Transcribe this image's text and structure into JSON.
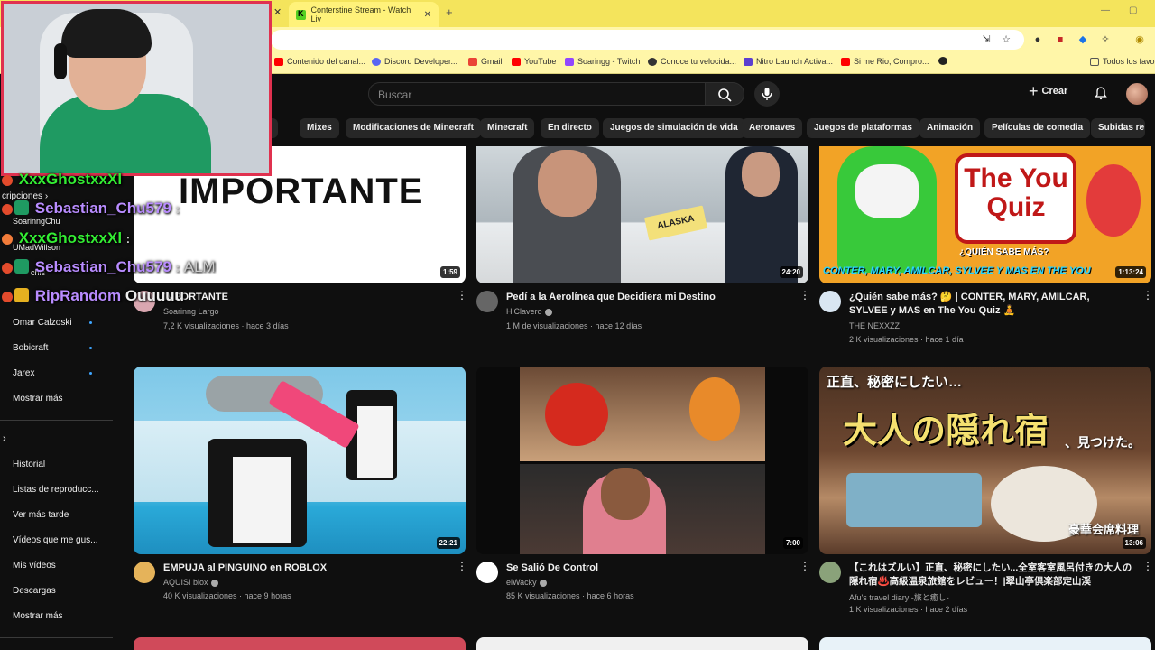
{
  "browser": {
    "active_tab_title": "Conterstine Stream - Watch Liv",
    "bookmarks": [
      {
        "label": "Contenido del canal...",
        "color": "#ff0000"
      },
      {
        "label": "Discord Developer...",
        "color": "#5865f2"
      },
      {
        "label": "Gmail",
        "color": "#ea4335"
      },
      {
        "label": "YouTube",
        "color": "#ff0000"
      },
      {
        "label": "Soaringg - Twitch",
        "color": "#9146ff"
      },
      {
        "label": "Conoce tu velocida...",
        "color": "#333333"
      },
      {
        "label": "Nitro Launch Activa...",
        "color": "#5b3fd0"
      },
      {
        "label": "Si me Rio, Compro...",
        "color": "#ff0000"
      }
    ],
    "other_bookmarks": "Todos los favor"
  },
  "header": {
    "search_placeholder": "Buscar",
    "create_label": "Crear"
  },
  "chips": [
    "ica",
    "Mixes",
    "Modificaciones de Minecraft",
    "Minecraft",
    "En directo",
    "Juegos de simulación de vida",
    "Aeronaves",
    "Juegos de plataformas",
    "Animación",
    "Películas de comedia",
    "Subidas re"
  ],
  "sidebar": {
    "subs_partial": "cripciones",
    "channels": [
      "SoarinngChu",
      "UMadWillson",
      "chis",
      "Omar Calzoski",
      "Bobicraft",
      "Jarex"
    ],
    "show_more": "Mostrar más",
    "you_items": [
      "Historial",
      "Listas de reproducc...",
      "Ver más tarde",
      "Vídeos que me gus...",
      "Mis vídeos",
      "Descargas"
    ],
    "show_more_2": "Mostrar más"
  },
  "videos": [
    {
      "title": "IMPORTANTE",
      "thumb_text": "IMPORTANTE",
      "channel": "Soarinng Largo",
      "meta": "7,2 K visualizaciones · hace 3 días",
      "duration": "1:59",
      "verified": false
    },
    {
      "title": "Pedí a la Aerolínea que Decidiera mi Destino",
      "thumb_text": "ALASKA",
      "channel": "HiClavero",
      "meta": "1 M de visualizaciones · hace 12 días",
      "duration": "24:20",
      "verified": true
    },
    {
      "title": "¿Quién sabe más? 🤔 | CONTER, MARY, AMILCAR, SYLVEE y MAS en The You Quiz 🧘",
      "thumb_text": "The You Quiz",
      "thumb_sub": "¿QUIÉN SABE MÁS?",
      "thumb_sub2": "CONTER, MARY, AMILCAR, SYLVEE Y MAS EN THE YOU",
      "channel": "THE NEXXZZ",
      "meta": "2 K visualizaciones · hace 1 día",
      "duration": "1:13:24",
      "verified": false
    },
    {
      "title": "EMPUJA al PINGUINO en ROBLOX",
      "channel": "AQUISI blox",
      "meta": "40 K visualizaciones · hace 9 horas",
      "duration": "22:21",
      "verified": true
    },
    {
      "title": "Se Salió De Control",
      "channel": "elWacky",
      "meta": "85 K visualizaciones · hace 6 horas",
      "duration": "7:00",
      "verified": true
    },
    {
      "title": "【これはズルい】正直、秘密にしたい...全室客室風呂付きの大人の隠れ宿♨️高級温泉旅館をレビュー！|翠山亭倶楽部定山渓",
      "thumb_text": "大人の隠れ宿",
      "thumb_top": "正直、秘密にしたい…",
      "thumb_after": "、見つけた。",
      "thumb_bottom": "豪華会席料理",
      "channel": "Afu's travel diary -旅と癒し-",
      "meta": "1 K visualizaciones · hace 2 días",
      "duration": "13:06",
      "verified": false
    }
  ],
  "chat": [
    {
      "user": "XxxGhostxxXl",
      "msg": ""
    },
    {
      "user": "Sebastian_Chu579",
      "msg": ""
    },
    {
      "user": "XxxGhostxxXl",
      "msg": ""
    },
    {
      "user": "Sebastian_Chu579",
      "msg": "ALM"
    },
    {
      "user": "RipRandom",
      "msg": "Ouuuuu"
    }
  ],
  "colors": {
    "chat_green": "#33ee33",
    "chat_purple": "#b98cff",
    "webcam_border": "#e0314f",
    "tabbar": "#f4e45c"
  }
}
